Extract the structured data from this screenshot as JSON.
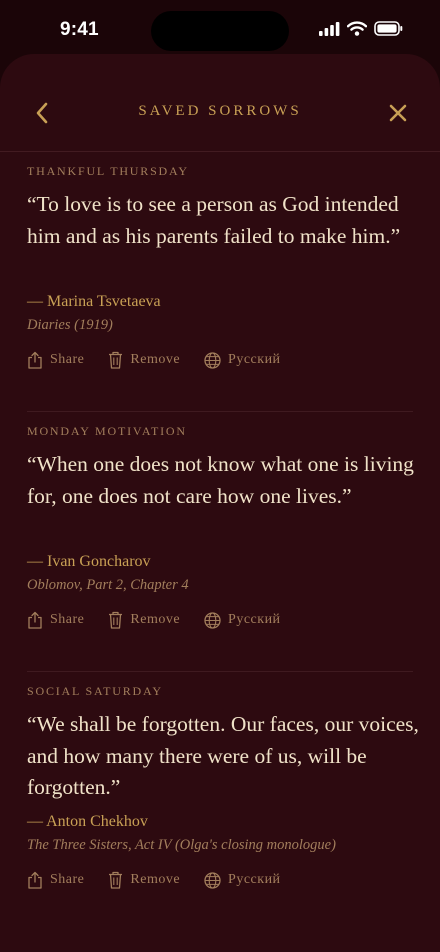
{
  "status_bar": {
    "time": "9:41"
  },
  "header": {
    "title": "SAVED SORROWS",
    "back_icon": "chevron-left-icon",
    "close_icon": "close-icon"
  },
  "colors": {
    "background": "#2d0a10",
    "accent_gold": "#c8a055",
    "muted": "#a27e5c",
    "quote_text": "#f0e2c8"
  },
  "actions": {
    "share_label": "Share",
    "remove_label": "Remove",
    "language_label": "Русский",
    "share_icon": "share-icon",
    "remove_icon": "trash-icon",
    "language_icon": "globe-icon"
  },
  "quotes": [
    {
      "category": "THANKFUL THURSDAY",
      "text": "“To love is to see a person as God intended him and as his parents failed to make him.”",
      "author": "— Marina Tsvetaeva",
      "source": "Diaries (1919)"
    },
    {
      "category": "MONDAY MOTIVATION",
      "text": "“When one does not know what one is living for, one does not care how one lives.”",
      "author": "— Ivan Goncharov",
      "source": "Oblomov, Part 2, Chapter 4"
    },
    {
      "category": "SOCIAL SATURDAY",
      "text": "“We shall be forgotten. Our faces, our voices, and how many there were of us, will be forgotten.”",
      "author": "— Anton Chekhov",
      "source": "The Three Sisters, Act IV (Olga's closing monologue)"
    }
  ]
}
